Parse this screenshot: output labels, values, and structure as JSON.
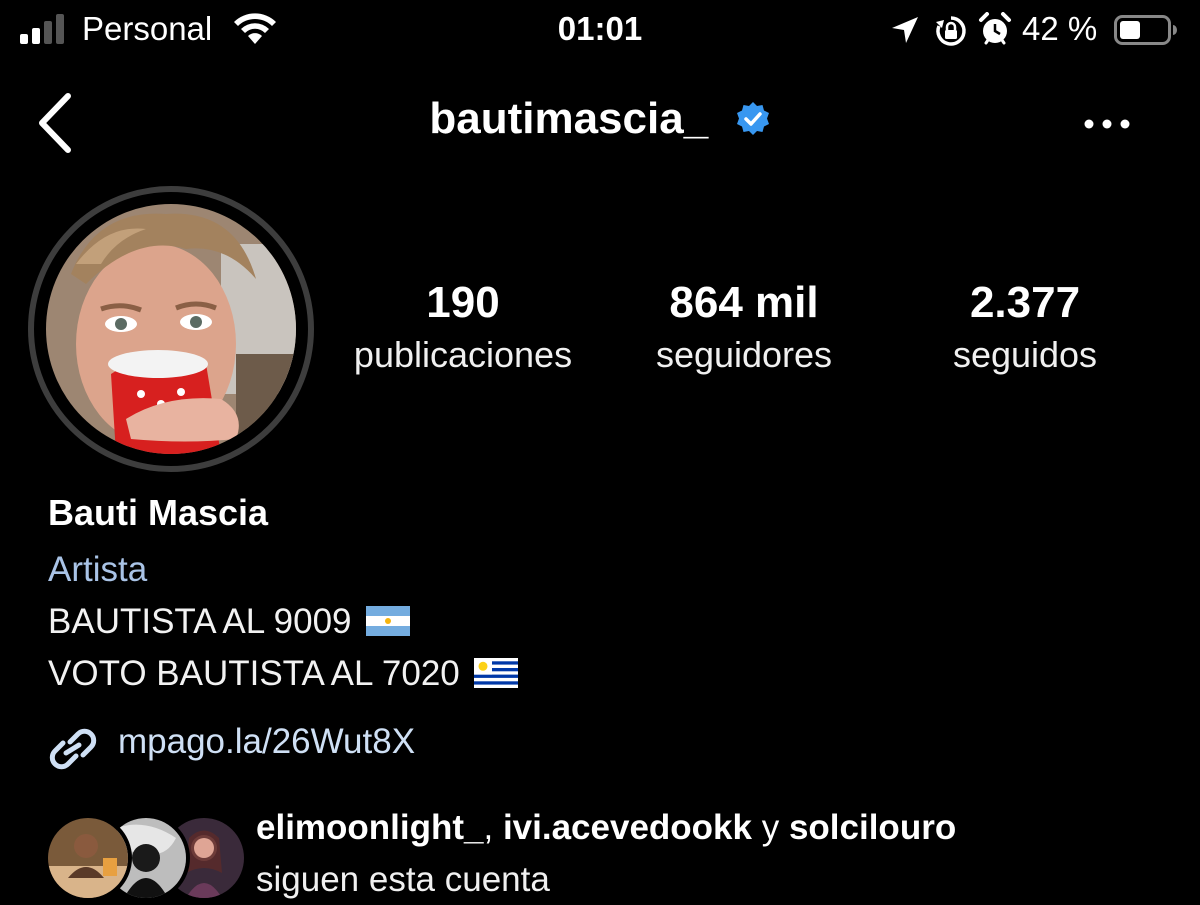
{
  "status_bar": {
    "carrier": "Personal",
    "time": "01:01",
    "battery": "42 %",
    "icons": [
      "signal-icon",
      "wifi-icon",
      "location-arrow-icon",
      "rotation-lock-icon",
      "alarm-icon",
      "battery-icon"
    ]
  },
  "header": {
    "username": "bautimascia_",
    "back_icon": "chevron-left-icon",
    "verified_icon": "verified-badge-icon",
    "more_icon": "more-dots-icon"
  },
  "stats": {
    "posts_count": "190",
    "posts_label": "publicaciones",
    "followers_count": "864 mil",
    "followers_label": "seguidores",
    "following_count": "2.377",
    "following_label": "seguidos"
  },
  "bio": {
    "name": "Bauti Mascia",
    "category": "Artista",
    "line1": "BAUTISTA AL 9009",
    "line2": "VOTO BAUTISTA AL 7020",
    "flag1": "argentina-flag-icon",
    "flag2": "uruguay-flag-icon",
    "link": "mpago.la/26Wut8X",
    "link_icon": "link-icon"
  },
  "followed_by": {
    "user1": "elimoonlight_",
    "sep1": ", ",
    "user2": "ivi.acevedookk",
    "sep2": " y ",
    "user3": "solcilouro",
    "suffix": "siguen esta cuenta"
  },
  "colors": {
    "background": "#000000",
    "text": "#ffffff",
    "category": "#a9c3e6",
    "link": "#cfe0f5",
    "verified": "#3897f0",
    "avatar_ring": "#3d3d3d"
  }
}
